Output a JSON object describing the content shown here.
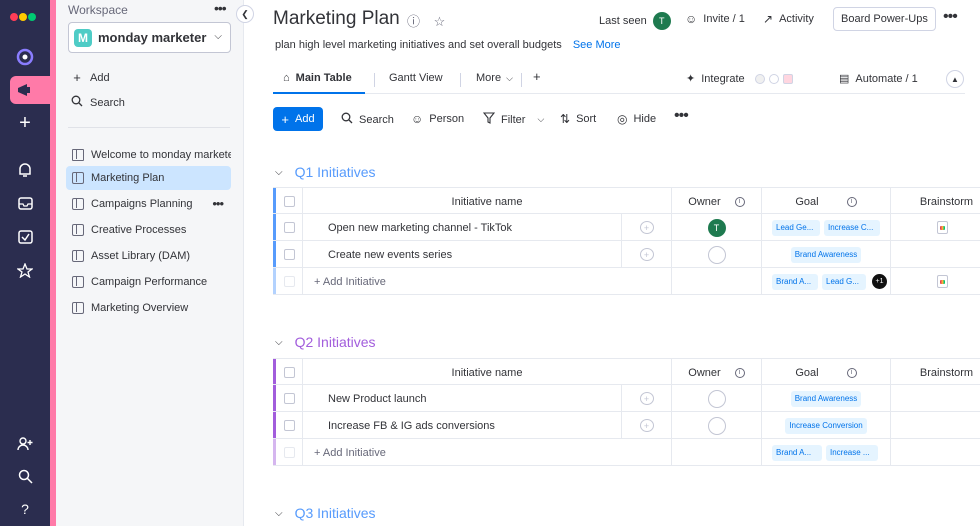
{
  "sidebar": {
    "workspace_label": "Workspace",
    "workspace_badge": "M",
    "workspace_name": "monday marketer",
    "add_label": "Add",
    "search_label": "Search",
    "items": [
      {
        "label": "Welcome to monday marketer"
      },
      {
        "label": "Marketing Plan"
      },
      {
        "label": "Campaigns Planning"
      },
      {
        "label": "Creative Processes"
      },
      {
        "label": "Asset Library (DAM)"
      },
      {
        "label": "Campaign Performance"
      },
      {
        "label": "Marketing Overview"
      }
    ]
  },
  "header": {
    "title": "Marketing Plan",
    "last_seen_label": "Last seen",
    "last_seen_avatar": "T",
    "invite_label": "Invite / 1",
    "activity_label": "Activity",
    "power_ups_label": "Board Power-Ups",
    "description": "plan high level marketing initiatives and set overall budgets",
    "see_more": "See More"
  },
  "tabs": {
    "main_table": "Main Table",
    "gantt_view": "Gantt View",
    "more": "More",
    "add": "+",
    "integrate": "Integrate",
    "automate": "Automate / 1"
  },
  "toolbar": {
    "add": "Add",
    "search": "Search",
    "person": "Person",
    "filter": "Filter",
    "sort": "Sort",
    "hide": "Hide"
  },
  "columns": {
    "name": "Initiative name",
    "owner": "Owner",
    "goal": "Goal",
    "brainstorm": "Brainstorm"
  },
  "groups": [
    {
      "title": "Q1 Initiatives",
      "color": "#579bfc",
      "rows": [
        {
          "name": "Open new marketing channel - TikTok",
          "owner": "T",
          "goals": [
            "Lead Ge...",
            "Increase C..."
          ]
        },
        {
          "name": "Create new events series",
          "owner": "",
          "goals": [
            "Brand Awareness"
          ]
        }
      ],
      "add_label": "+ Add Initiative",
      "summary_goals": [
        "Brand A...",
        "Lead G..."
      ],
      "summary_extra": "+1"
    },
    {
      "title": "Q2 Initiatives",
      "color": "#a25ddc",
      "rows": [
        {
          "name": "New Product launch",
          "owner": "",
          "goals": [
            "Brand Awareness"
          ]
        },
        {
          "name": "Increase FB & IG ads conversions",
          "owner": "",
          "goals": [
            "Increase Conversion"
          ]
        }
      ],
      "add_label": "+ Add Initiative",
      "summary_goals": [
        "Brand A...",
        "Increase ..."
      ]
    },
    {
      "title": "Q3 Initiatives",
      "color": "#579bfc"
    }
  ]
}
